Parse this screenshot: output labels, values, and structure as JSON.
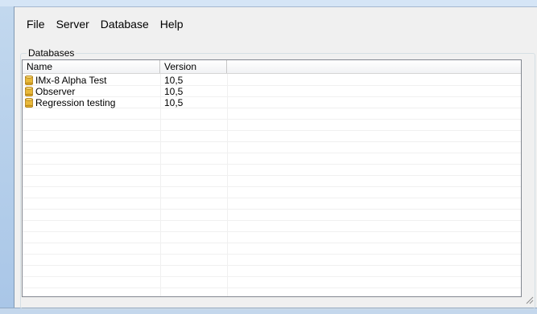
{
  "menu": {
    "file": "File",
    "server": "Server",
    "database": "Database",
    "help": "Help"
  },
  "databases_group": {
    "label": "Databases",
    "columns": {
      "name": "Name",
      "version": "Version"
    },
    "rows": [
      {
        "name": "IMx-8 Alpha Test",
        "version": "10,5",
        "icon": "database-icon"
      },
      {
        "name": "Observer",
        "version": "10,5",
        "icon": "database-icon"
      },
      {
        "name": "Regression testing",
        "version": "10,5",
        "icon": "database-icon"
      }
    ]
  },
  "colors": {
    "client_background": "#f0f0f0",
    "list_background": "#ffffff",
    "icon_gold": "#e8b93b",
    "window_chrome": "#b8d0eb"
  }
}
